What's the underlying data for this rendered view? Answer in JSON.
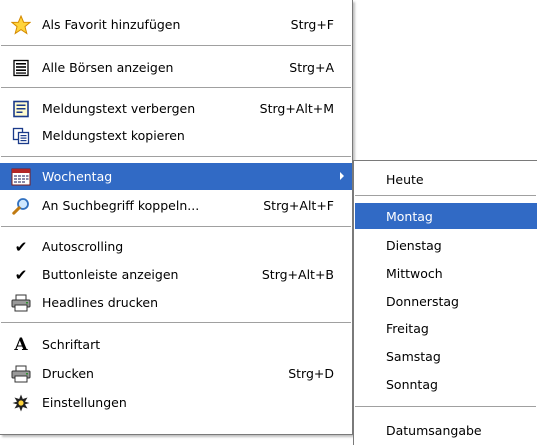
{
  "main_menu": {
    "items": [
      {
        "label": "Als Favorit hinzufügen",
        "shortcut": "Strg+F",
        "icon": "star-icon"
      },
      {
        "label": "Alle Börsen anzeigen",
        "shortcut": "Strg+A",
        "icon": "list-document-icon"
      },
      {
        "label": "Meldungstext verbergen",
        "shortcut": "Strg+Alt+M",
        "icon": "hide-text-icon"
      },
      {
        "label": "Meldungstext kopieren",
        "shortcut": "",
        "icon": "copy-icon"
      },
      {
        "label": "Wochentag",
        "shortcut": "",
        "icon": "calendar-icon",
        "highlighted": true,
        "has_submenu": true
      },
      {
        "label": "An Suchbegriff koppeln...",
        "shortcut": "Strg+Alt+F",
        "icon": "magnifier-icon"
      },
      {
        "label": "Autoscrolling",
        "shortcut": "",
        "icon": "checkmark-icon",
        "checked": true
      },
      {
        "label": "Buttonleiste anzeigen",
        "shortcut": "Strg+Alt+B",
        "icon": "checkmark-icon",
        "checked": true
      },
      {
        "label": "Headlines drucken",
        "shortcut": "",
        "icon": "printer-icon"
      },
      {
        "label": "Schriftart",
        "shortcut": "",
        "icon": "font-icon"
      },
      {
        "label": "Drucken",
        "shortcut": "Strg+D",
        "icon": "printer-icon"
      },
      {
        "label": "Einstellungen",
        "shortcut": "",
        "icon": "settings-gear-icon"
      }
    ]
  },
  "submenu": {
    "items": [
      {
        "label": "Heute"
      },
      {
        "label": "Montag",
        "highlighted": true
      },
      {
        "label": "Dienstag"
      },
      {
        "label": "Mittwoch"
      },
      {
        "label": "Donnerstag"
      },
      {
        "label": "Freitag"
      },
      {
        "label": "Samstag"
      },
      {
        "label": "Sonntag"
      },
      {
        "label": "Datumsangabe"
      }
    ]
  },
  "colors": {
    "highlight": "#316ac5",
    "highlight_text": "#ffffff",
    "separator": "#a0a0a0"
  }
}
